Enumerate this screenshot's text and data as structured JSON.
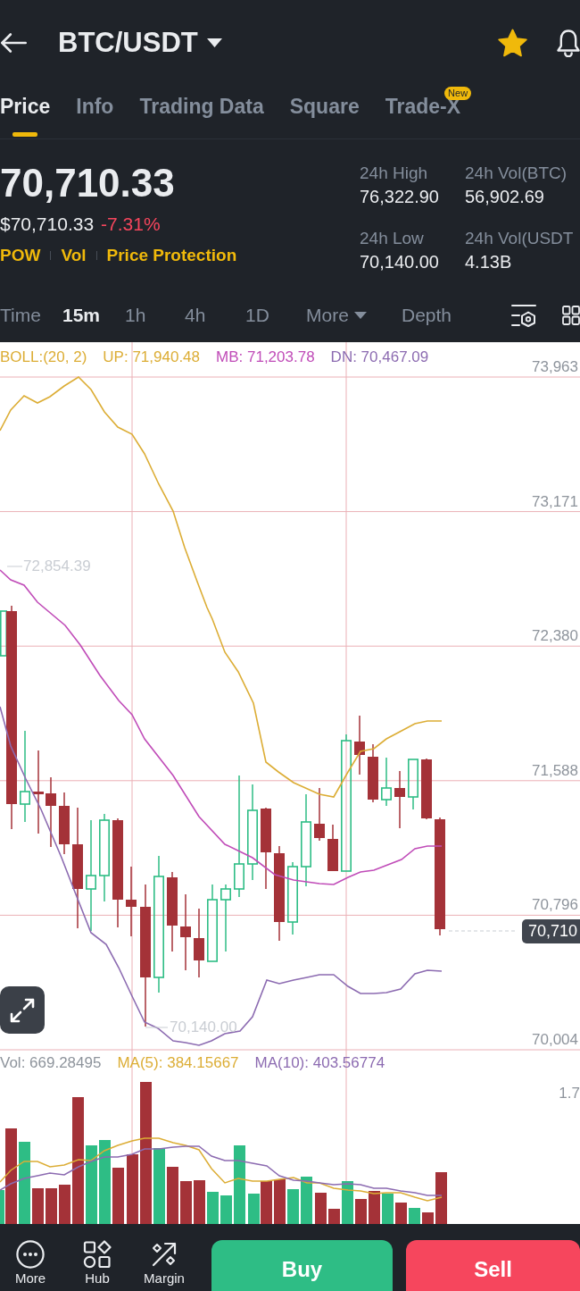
{
  "header": {
    "title": "BTC/USDT",
    "favorited": true
  },
  "tabs": [
    {
      "label": "Price",
      "selected": true
    },
    {
      "label": "Info",
      "selected": false
    },
    {
      "label": "Trading Data",
      "selected": false
    },
    {
      "label": "Square",
      "selected": false
    },
    {
      "label": "Trade-X",
      "selected": false,
      "badge": "New"
    }
  ],
  "ticker": {
    "last_price": "70,710.33",
    "fiat_price": "$70,710.33",
    "change": "-7.31%",
    "falling": true,
    "tags": [
      "POW",
      "Vol",
      "Price Protection"
    ],
    "stats": [
      {
        "label": "24h High",
        "value": "76,322.90"
      },
      {
        "label": "24h Vol(BTC)",
        "value": "56,902.69"
      },
      {
        "label": "24h Low",
        "value": "70,140.00"
      },
      {
        "label": "24h Vol(USDT",
        "value": "4.13B"
      }
    ]
  },
  "intervals": [
    {
      "label": "Time",
      "kind": "option",
      "selected": false
    },
    {
      "label": "15m",
      "kind": "option",
      "selected": true
    },
    {
      "label": "1h",
      "kind": "option",
      "selected": false
    },
    {
      "label": "4h",
      "kind": "option",
      "selected": false
    },
    {
      "label": "1D",
      "kind": "option",
      "selected": false
    },
    {
      "label": "More",
      "kind": "dropdown",
      "selected": false
    },
    {
      "label": "Depth",
      "kind": "option",
      "selected": false
    }
  ],
  "chart": {
    "legend": [
      {
        "label": "BOLL:(20, 2)",
        "color": "#dcad35"
      },
      {
        "label": "UP: 71,940.48",
        "color": "#dcad35"
      },
      {
        "label": "MB: 71,203.78",
        "color": "#c04cb8"
      },
      {
        "label": "DN: 70,467.09",
        "color": "#8c6bb1"
      }
    ],
    "price_axis": [
      "73,963",
      "73,171",
      "72,380",
      "71,588",
      "70,796",
      "70,004"
    ],
    "high_marker": "72,854.39",
    "low_marker": "70,140.00",
    "last_price_tag": "70,710",
    "volume_legend": [
      {
        "label": "Vol: 669.28495",
        "color": "#8e949c"
      },
      {
        "label": "MA(5): 384.15667",
        "color": "#dcad35"
      },
      {
        "label": "MA(10): 403.56774",
        "color": "#8c6bb1"
      }
    ],
    "volume_axis": "1.7"
  },
  "bottom_bar": {
    "actions": [
      "More",
      "Hub",
      "Margin"
    ],
    "buy": "Buy",
    "sell": "Sell"
  }
}
